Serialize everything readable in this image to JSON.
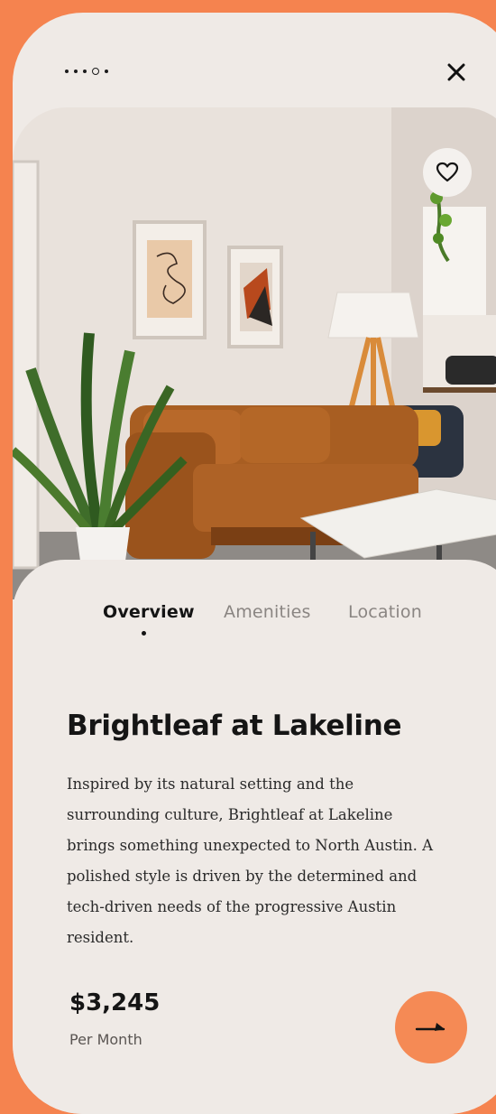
{
  "header": {
    "pagination": {
      "total": 5,
      "active_index": 3
    },
    "close_icon": "close-icon"
  },
  "hero": {
    "image_alt": "Living room with leather sofa",
    "favorite_icon": "heart-icon"
  },
  "tabs": [
    {
      "label": "Overview",
      "active": true
    },
    {
      "label": "Amenities",
      "active": false
    },
    {
      "label": "Location",
      "active": false
    }
  ],
  "listing": {
    "title": "Brightleaf at Lakeline",
    "description": "Inspired by its natural setting and the surrounding culture, Brightleaf at Lakeline brings something unexpected to North Austin. A polished style is driven by the determined and tech-driven needs of the progressive Austin resident.",
    "price": "$3,245",
    "price_period": "Per Month"
  },
  "actions": {
    "next_icon": "arrow-right-icon"
  },
  "colors": {
    "accent": "#F5834F",
    "background": "#EFEAE6",
    "text": "#151515"
  }
}
